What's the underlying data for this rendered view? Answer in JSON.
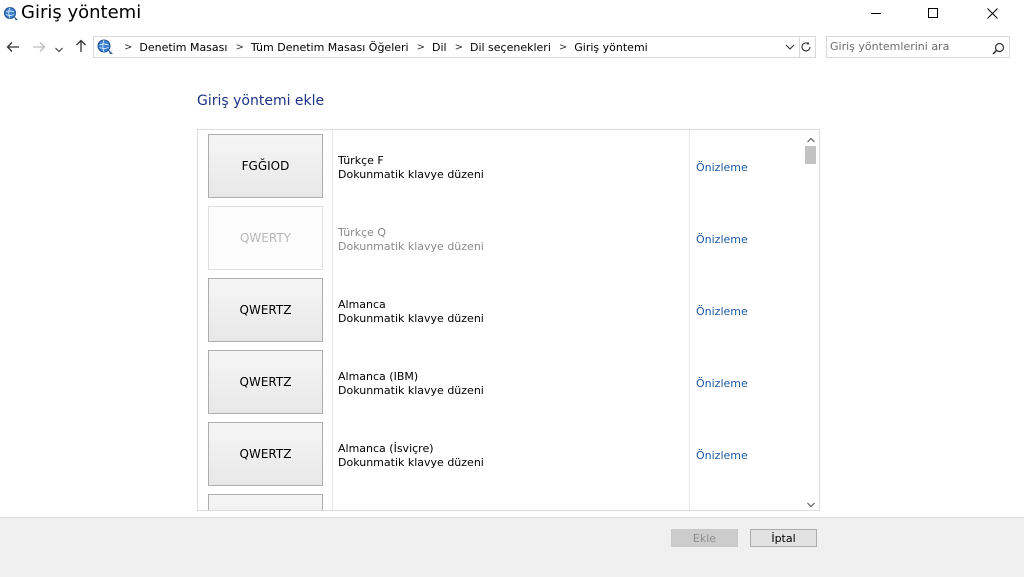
{
  "window": {
    "title": "Giriş yöntemi",
    "app_icon": "language-globe-icon",
    "controls": [
      "minimize-icon",
      "maximize-icon",
      "close-icon"
    ]
  },
  "nav": {
    "back_icon": "arrow-left-icon",
    "forward_icon": "arrow-right-icon",
    "recent_icon": "chevron-down-icon",
    "up_icon": "arrow-up-icon"
  },
  "address": {
    "crumbs": [
      "Denetim Masası",
      "Tüm Denetim Masası Öğeleri",
      "Dil",
      "Dil seçenekleri",
      "Giriş yöntemi"
    ],
    "refresh_icon": "refresh-icon"
  },
  "search": {
    "placeholder": "Giriş yöntemlerini ara",
    "value": ""
  },
  "main": {
    "heading": "Giriş yöntemi ekle",
    "rows": [
      {
        "layout": "FGĞIOD",
        "language": "Türkçe F",
        "description": "Dokunmatik klavye düzeni",
        "link": "Önizleme",
        "disabled": false
      },
      {
        "layout": "QWERTY",
        "language": "Türkçe Q",
        "description": "Dokunmatik klavye düzeni",
        "link": "Önizleme",
        "disabled": true
      },
      {
        "layout": "QWERTZ",
        "language": "Almanca",
        "description": "Dokunmatik klavye düzeni",
        "link": "Önizleme",
        "disabled": false
      },
      {
        "layout": "QWERTZ",
        "language": "Almanca (IBM)",
        "description": "Dokunmatik klavye düzeni",
        "link": "Önizleme",
        "disabled": false
      },
      {
        "layout": "QWERTZ",
        "language": "Almanca (İsviçre)",
        "description": "Dokunmatik klavye düzeni",
        "link": "Önizleme",
        "disabled": false
      }
    ]
  },
  "footer": {
    "add_label": "Ekle",
    "cancel_label": "İptal"
  },
  "colors": {
    "heading": "#1e3287",
    "link": "#1a5aa8",
    "footer_bg": "#f0f0f0"
  }
}
